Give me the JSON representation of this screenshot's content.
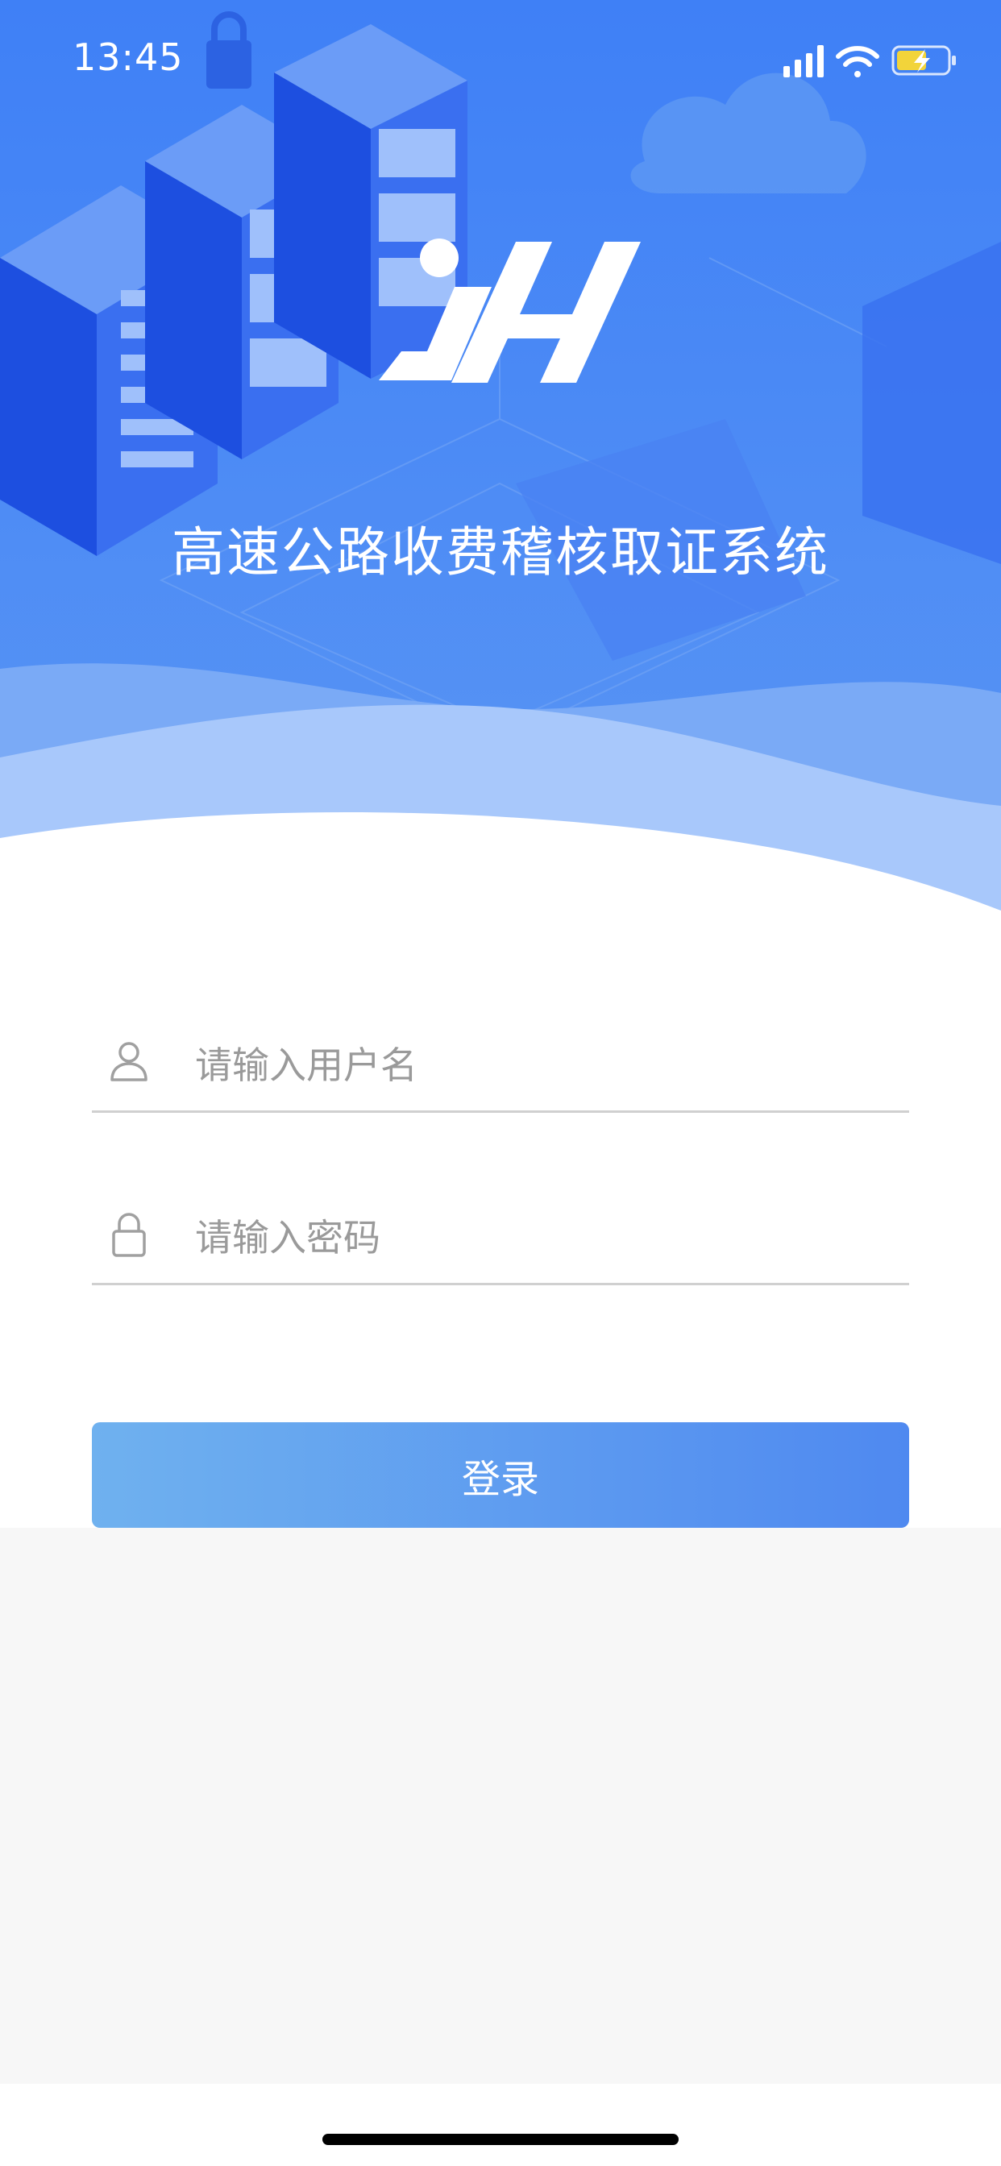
{
  "status_bar": {
    "time": "13:45",
    "icons": [
      "signal-icon",
      "wifi-icon",
      "battery-charging-icon"
    ]
  },
  "header": {
    "logo_icon": "jh-logo",
    "title": "高速公路收费稽核取证系统"
  },
  "login_form": {
    "username": {
      "icon": "user-icon",
      "placeholder": "请输入用户名",
      "value": ""
    },
    "password": {
      "icon": "lock-icon",
      "placeholder": "请输入密码",
      "value": ""
    },
    "submit_label": "登录"
  },
  "colors": {
    "header_blue": "#4b88f5",
    "button_gradient_start": "#6fb1ef",
    "button_gradient_end": "#4f89f0",
    "input_underline": "#d0d0d0",
    "page_grey": "#f7f7f7"
  }
}
